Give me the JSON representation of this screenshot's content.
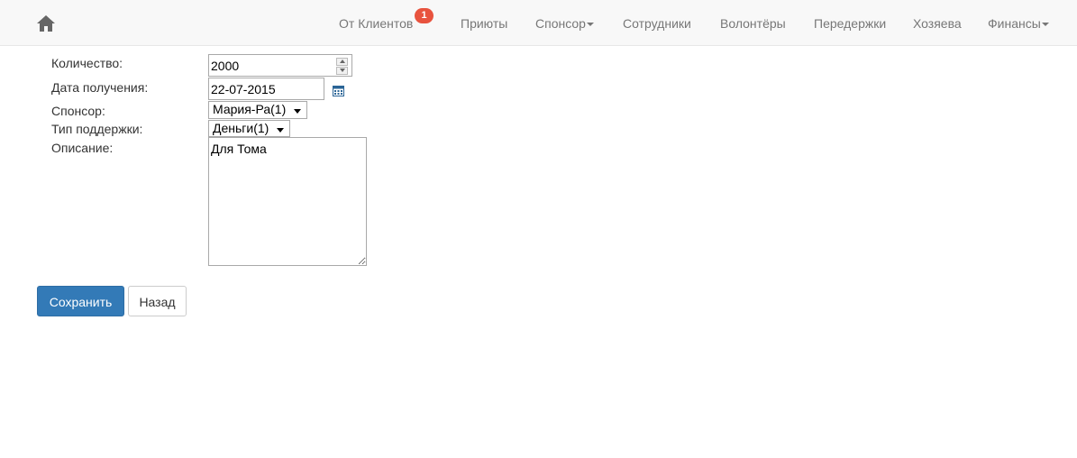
{
  "navbar": {
    "home_icon": "home-icon",
    "items": [
      {
        "label": "От Клиентов",
        "badge": "1"
      },
      {
        "label": "Приюты"
      },
      {
        "label": "Спонсор"
      },
      {
        "label": "Сотрудники"
      },
      {
        "label": "Волонтёры"
      },
      {
        "label": "Передержки"
      },
      {
        "label": "Хозяева"
      },
      {
        "label": "Финансы"
      }
    ]
  },
  "form": {
    "quantity": {
      "label": "Количество:",
      "value": "2000"
    },
    "date": {
      "label": "Дата получения:",
      "value": "22-07-2015",
      "icon": "calendar-icon"
    },
    "sponsor": {
      "label": "Спонсор:",
      "value": "Мария-Ра(1)"
    },
    "support_type": {
      "label": "Тип поддержки:",
      "value": "Деньги(1)"
    },
    "description": {
      "label": "Описание:",
      "value": "Для Тома"
    }
  },
  "buttons": {
    "save": "Сохранить",
    "back": "Назад"
  },
  "colors": {
    "primary": "#337ab7",
    "badge": "#e8533e",
    "nav_bg": "#f8f8f8"
  }
}
